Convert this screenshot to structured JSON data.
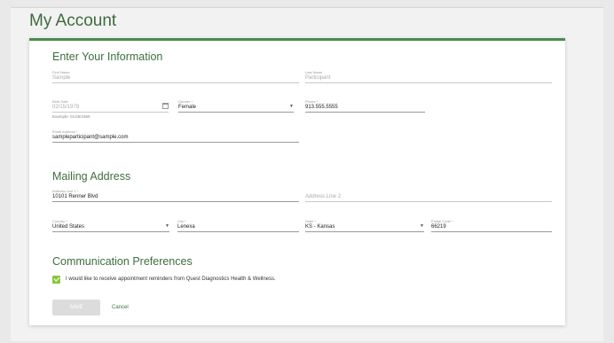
{
  "page": {
    "title": "My Account"
  },
  "sections": {
    "info": "Enter Your Information",
    "mailing": "Mailing Address",
    "comm": "Communication Preferences"
  },
  "fields": {
    "first_name": {
      "label": "First Name",
      "value": "Sample"
    },
    "last_name": {
      "label": "Last Name",
      "value": "Participant"
    },
    "birth_date": {
      "label": "Birth Date",
      "value": "02/15/1979",
      "hint": "Example: 01/25/1965"
    },
    "gender": {
      "label": "Gender *",
      "value": "Female"
    },
    "phone": {
      "label": "Phone *",
      "value": "913.555.5555"
    },
    "email": {
      "label": "Email Address *",
      "value": "sampleparticipant@sample.com"
    },
    "address1": {
      "label": "Address Line 1 *",
      "value": "10101 Renner Blvd"
    },
    "address2": {
      "placeholder": "Address Line 2"
    },
    "country": {
      "label": "Country *",
      "value": "United States"
    },
    "city": {
      "label": "City *",
      "value": "Lenexa"
    },
    "state": {
      "label": "State *",
      "value": "KS - Kansas"
    },
    "postal": {
      "label": "Postal Code *",
      "value": "66219"
    }
  },
  "preferences": {
    "checked": true,
    "reminder_text": "I would like to receive appointment reminders from Quest Diagnostics Health & Wellness."
  },
  "buttons": {
    "save": "SAVE",
    "cancel": "Cancel"
  },
  "colors": {
    "accent": "#4e8a4e",
    "heading": "#3e6e3e",
    "checkbox": "#8cc63f"
  }
}
